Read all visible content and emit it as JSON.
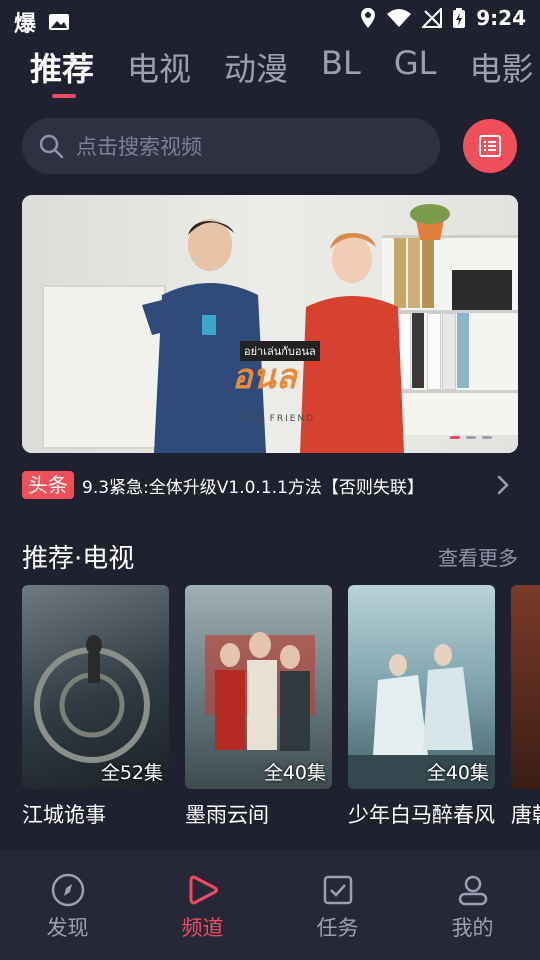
{
  "status": {
    "time": "9:24",
    "left_icons": [
      "app-icon",
      "image-icon"
    ],
    "right_icons": [
      "location-icon",
      "wifi-icon",
      "no-signal-icon",
      "battery-charging-icon"
    ]
  },
  "tabs": [
    {
      "label": "推荐",
      "active": true
    },
    {
      "label": "电视",
      "active": false
    },
    {
      "label": "动漫",
      "active": false
    },
    {
      "label": "BL",
      "active": false
    },
    {
      "label": "GL",
      "active": false
    },
    {
      "label": "电影",
      "active": false
    }
  ],
  "search": {
    "placeholder": "点击搜索视频"
  },
  "banner": {
    "title_art": "อย่าเล่นกับอนล",
    "logo_text": "อนล",
    "subtitle": "BED FRIEND",
    "slides": 3,
    "active_slide": 1
  },
  "news": {
    "badge": "头条",
    "text": "9.3紧急:全体升级V1.0.1.1方法【否则失联】"
  },
  "section": {
    "title": "推荐·电视",
    "more": "查看更多"
  },
  "cards": [
    {
      "name": "江城诡事",
      "episodes": "全52集",
      "color": "#4a5560"
    },
    {
      "name": "墨雨云间",
      "episodes": "全40集",
      "color": "#5a6b73"
    },
    {
      "name": "少年白马醉春风",
      "episodes": "全40集",
      "color": "#5a7a86"
    },
    {
      "name": "唐朝",
      "episodes": "",
      "color": "#6b3a2a"
    }
  ],
  "bottom_nav": [
    {
      "label": "发现",
      "icon": "compass-icon",
      "active": false
    },
    {
      "label": "频道",
      "icon": "play-icon",
      "active": true
    },
    {
      "label": "任务",
      "icon": "task-icon",
      "active": false
    },
    {
      "label": "我的",
      "icon": "profile-icon",
      "active": false
    }
  ],
  "colors": {
    "accent": "#f04a5d",
    "background": "#1f2130"
  }
}
